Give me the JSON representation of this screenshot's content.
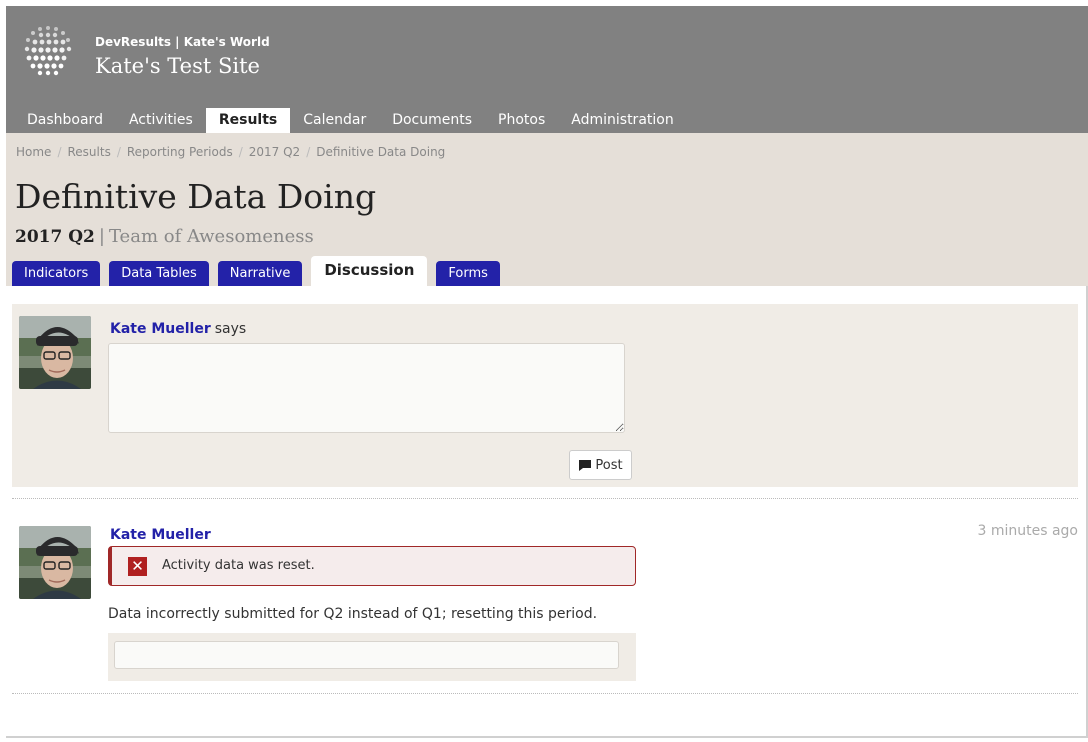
{
  "header": {
    "org": "DevResults | Kate's World",
    "site": "Kate's Test Site"
  },
  "nav": {
    "items": [
      {
        "label": "Dashboard"
      },
      {
        "label": "Activities"
      },
      {
        "label": "Results",
        "active": true
      },
      {
        "label": "Calendar"
      },
      {
        "label": "Documents"
      },
      {
        "label": "Photos"
      },
      {
        "label": "Administration"
      }
    ]
  },
  "breadcrumb": {
    "items": [
      "Home",
      "Results",
      "Reporting Periods",
      "2017 Q2",
      "Definitive Data Doing"
    ],
    "separator": "/"
  },
  "page": {
    "title": "Definitive Data Doing",
    "period": "2017 Q2",
    "divider": "|",
    "team": "Team of Awesomeness"
  },
  "tabs": [
    {
      "label": "Indicators"
    },
    {
      "label": "Data Tables"
    },
    {
      "label": "Narrative"
    },
    {
      "label": "Discussion",
      "active": true
    },
    {
      "label": "Forms"
    }
  ],
  "composer": {
    "author": "Kate Mueller",
    "says": "says",
    "comment_value": "",
    "post_label": "Post",
    "post_icon": "comment-icon"
  },
  "entry": {
    "author": "Kate Mueller",
    "time": "3 minutes ago",
    "alert_text": "Activity data was reset.",
    "alert_icon": "close-x-icon",
    "body": "Data incorrectly submitted for Q2 instead of Q1; resetting this period.",
    "reply_value": ""
  },
  "colors": {
    "banner": "#818181",
    "header_band": "#e5dfd8",
    "tab_blue": "#2322a8",
    "link": "#2322a8",
    "alert": "#a02828"
  }
}
